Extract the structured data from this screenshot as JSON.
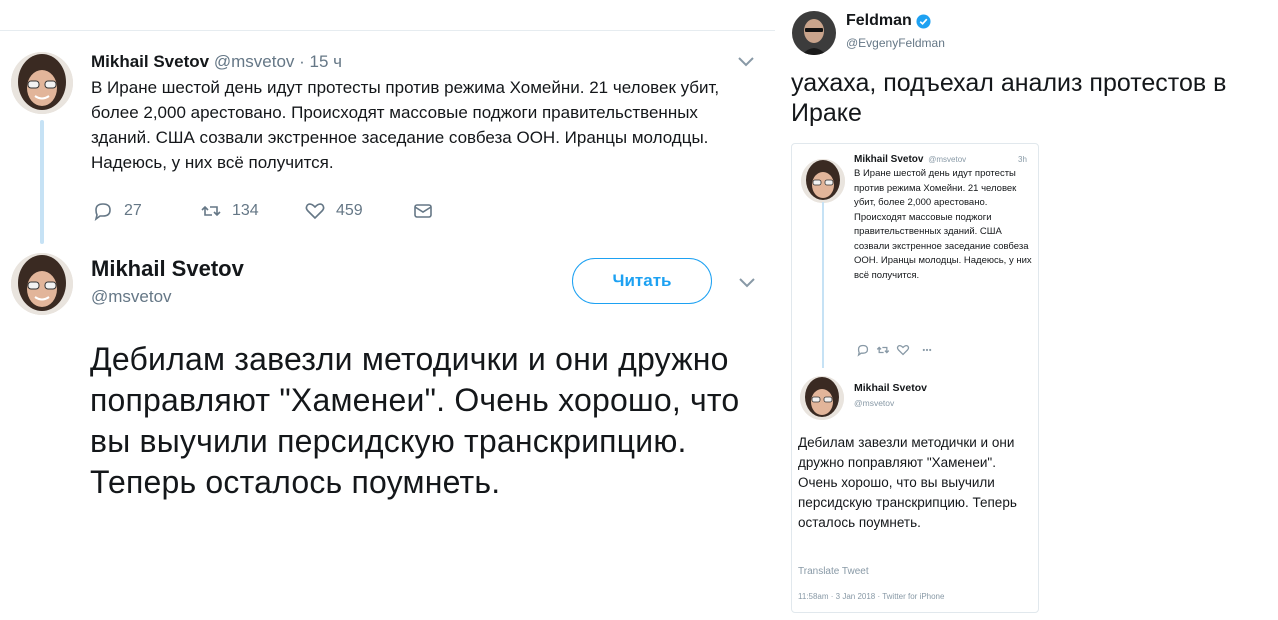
{
  "left_tweet": {
    "author_name": "Mikhail Svetov",
    "author_handle": "@msvetov",
    "separator": "·",
    "time": "15 ч",
    "text": "В Иране шестой день идут протесты против режима Хомейни. 21 человек убит, более 2,000 арестовано. Происходят массовые поджоги правительственных зданий. США созвали экстренное заседание совбеза ООН. Иранцы молодцы. Надеюсь, у них всё получится.",
    "reply_count": "27",
    "retweet_count": "134",
    "like_count": "459",
    "icons": [
      "reply-icon",
      "retweet-icon",
      "like-icon",
      "direct-message-icon",
      "chevron-down-icon"
    ]
  },
  "left_reply": {
    "author_name": "Mikhail Svetov",
    "author_handle": "@msvetov",
    "follow_label": "Читать",
    "text": "Дебилам завезли методички и они дружно поправляют \"Хаменеи\". Очень хорошо, что вы выучили персидскую транскрипцию. Теперь осталось поумнеть."
  },
  "right_post": {
    "author_name": "Feldman",
    "author_handle": "@EvgenyFeldman",
    "text": "уахаха, подъехал анализ протестов в Ираке",
    "verified_icon": "verified-badge-icon"
  },
  "embedded": {
    "tweet": {
      "author_name": "Mikhail Svetov",
      "author_handle": "@msvetov",
      "time": "3h",
      "text": "В Иране шестой день идут протесты против режима Хомейни. 21 человек убит, более 2,000 арестовано. Происходят массовые поджоги правительственных зданий. США созвали экстренное заседание совбеза ООН. Иранцы молодцы. Надеюсь, у них всё получится."
    },
    "reply": {
      "author_name": "Mikhail Svetov",
      "author_handle": "@msvetov",
      "text": "Дебилам завезли методички и они дружно поправляют \"Хаменеи\". Очень хорошо, что вы выучили персидскую транскрипцию. Теперь осталось поумнеть.",
      "translate_label": "Translate Tweet",
      "meta": "11:58am · 3 Jan 2018 · Twitter for iPhone"
    }
  },
  "colors": {
    "text": "#14171a",
    "muted": "#657786",
    "accent": "#1da1f2",
    "thread_line": "#c6e2f5",
    "divider": "#e1e8ed"
  }
}
